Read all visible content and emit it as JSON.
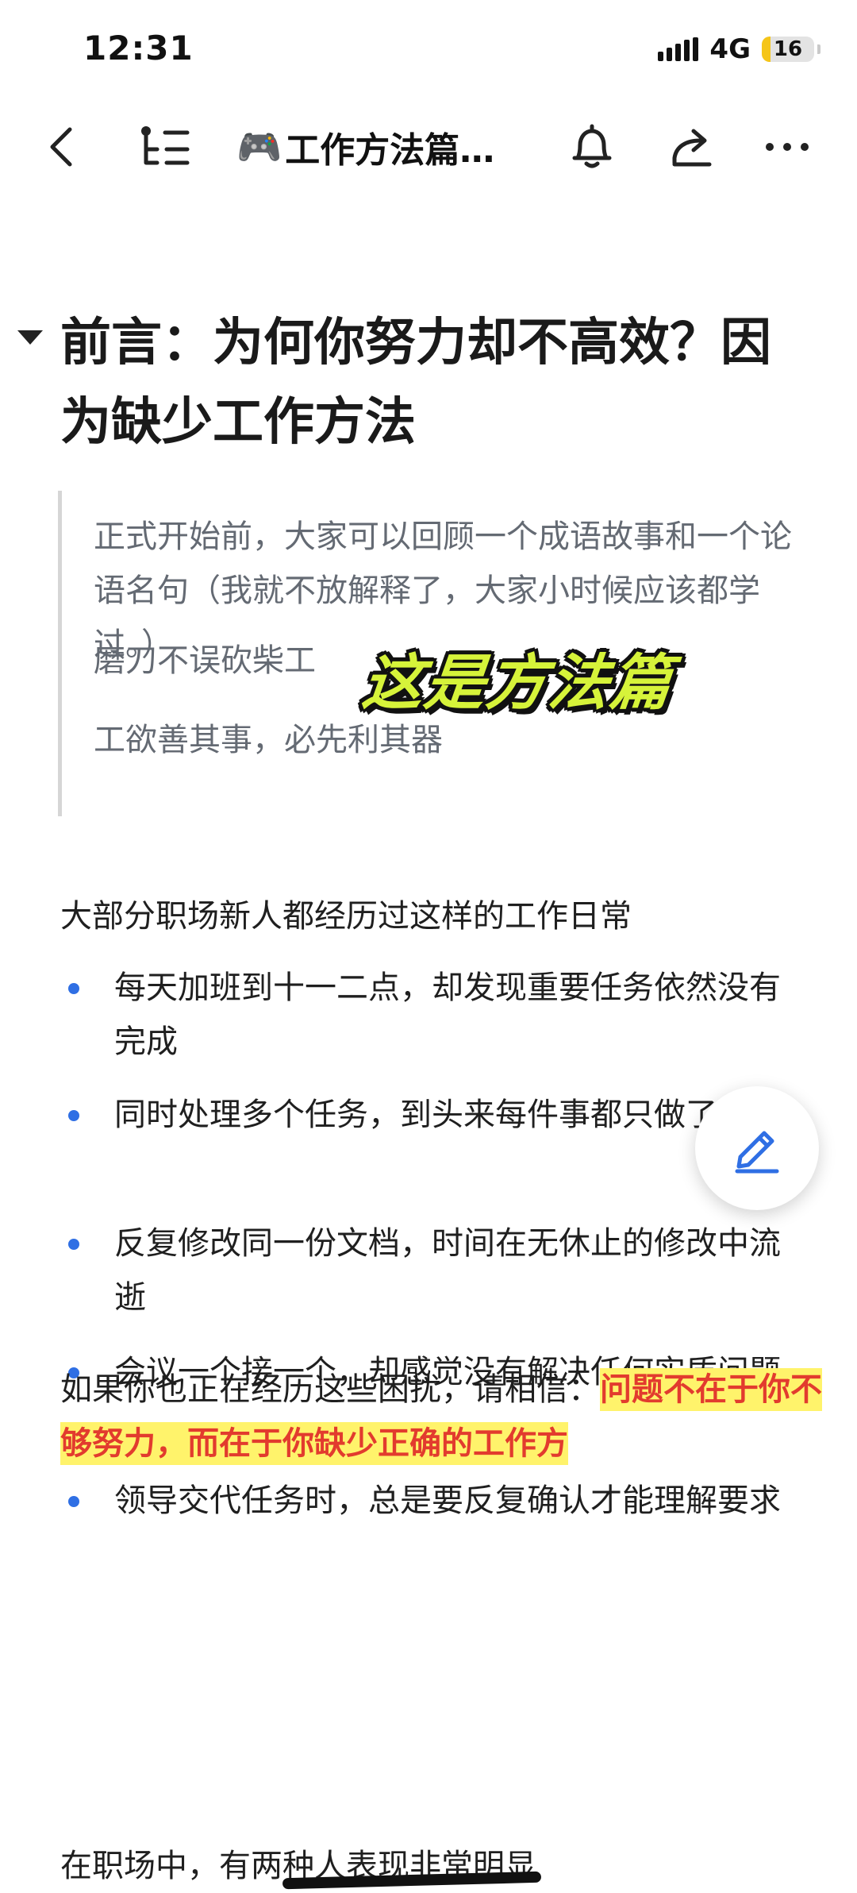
{
  "status_bar": {
    "time": "12:31",
    "network": "4G",
    "battery": "16",
    "battery_level_percent": 16
  },
  "nav": {
    "title_emoji": "🎮",
    "title": "工作方法篇…",
    "icons": [
      "back-icon",
      "outline-icon",
      "bell-icon",
      "share-icon",
      "more-icon"
    ]
  },
  "doc": {
    "heading": "前言：为何你努力却不高效？因为缺少工作方法",
    "quote": {
      "line1": "正式开始前，大家可以回顾一个成语故事和一个论语名句（我就不放解释了，大家小时候应该都学过。）",
      "line2": "磨刀不误砍柴工",
      "line3": "工欲善其事，必先利其器"
    },
    "sticker": "这是方法篇",
    "intro": "大部分职场新人都经历过这样的工作日常",
    "bullets": [
      "每天加班到十一二点，却发现重要任务依然没有完成",
      "同时处理多个任务，到头来每件事都只做了一半",
      "反复修改同一份文档，时间在无休止的修改中流逝",
      "会议一个接一个，却感觉没有解决任何实质问题",
      "领导交代任务时，总是要反复确认才能理解要求"
    ],
    "callout_prefix": "如果你也正在经历这些困扰，请相信：",
    "callout_highlight": "问题不在于你不够努力，而在于你缺少正确的工作方",
    "tail_prefix": "在职场中，有",
    "tail_struck": "两种人表现非常明显"
  },
  "colors": {
    "accent_blue": "#2f6fe4",
    "highlight_bg": "#fff36b",
    "highlight_text": "#e23b2e",
    "quote_text": "#646a73",
    "sticker": "#d6f33a"
  }
}
